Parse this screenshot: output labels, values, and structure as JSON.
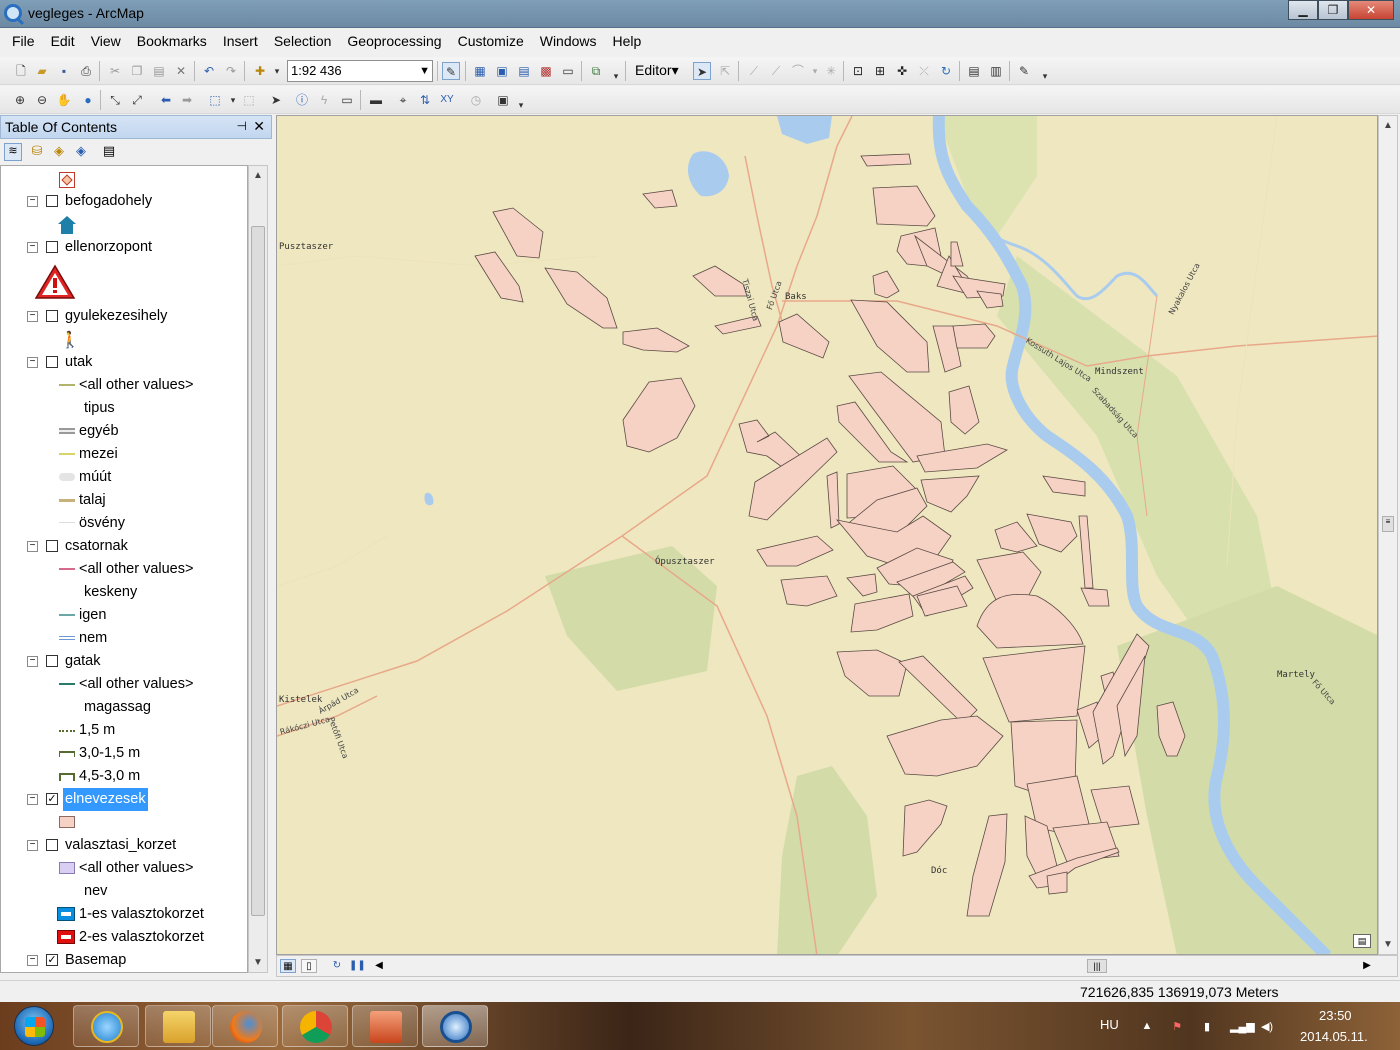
{
  "window": {
    "title": "vegleges - ArcMap",
    "minimize": "▁",
    "maximize": "❐",
    "close": "✕"
  },
  "menu": [
    "File",
    "Edit",
    "View",
    "Bookmarks",
    "Insert",
    "Selection",
    "Geoprocessing",
    "Customize",
    "Windows",
    "Help"
  ],
  "toolbar": {
    "scale": "1:92 436",
    "editor_label": "Editor▾"
  },
  "toc": {
    "title": "Table Of Contents",
    "pin": "⊣",
    "close": "✕",
    "layers": {
      "befogadohely": "befogadohely",
      "ellenorzopont": "ellenorzopont",
      "gyulekezesihely": "gyulekezesihely",
      "utak": "utak",
      "utak_other": "<all other values>",
      "utak_field": "tipus",
      "utak_v1": "egyéb",
      "utak_v2": "mezei",
      "utak_v3": "múút",
      "utak_v4": "talaj",
      "utak_v5": "ösvény",
      "csatornak": "csatornak",
      "csatornak_other": "<all other values>",
      "csatornak_field": "keskeny",
      "csatornak_v1": "igen",
      "csatornak_v2": "nem",
      "gatak": "gatak",
      "gatak_other": "<all other values>",
      "gatak_field": "magassag",
      "gatak_v1": "1,5 m",
      "gatak_v2": "3,0-1,5 m",
      "gatak_v3": "4,5-3,0 m",
      "elnevezesek": "elnevezesek",
      "valasztasi_korzet": "valasztasi_korzet",
      "vk_other": "<all other values>",
      "vk_field": "nev",
      "vk_v1": "1-es valasztokorzet",
      "vk_v2": "2-es valasztokorzet",
      "basemap": "Basemap"
    }
  },
  "map": {
    "places": {
      "pusztaszer": "Pusztaszer",
      "baks": "Baks",
      "mindszent": "Mindszent",
      "opusztaszer": "Ópusztaszer",
      "kistelek": "Kistelek",
      "martely": "Martely",
      "doc": "Dóc"
    },
    "streets": {
      "tiszai": "Tiszai Utca",
      "fo": "Fő Utca",
      "kossuth": "Kossuth Lajos Utca",
      "szabadsag": "Szabadság Utca",
      "nyakalos": "Nyakalos Utca",
      "arpad": "Árpád Utca",
      "rakoczi": "Rákóczi Utca",
      "petofi": "Petőfi Utca",
      "fo2": "Fő Utca"
    },
    "colors": {
      "background": "#efe7c0",
      "polygon_fill": "#f6d2c4",
      "polygon_stroke": "#5a4a44",
      "river": "#a9ccee",
      "forest": "#d3dca8"
    }
  },
  "status": {
    "coords": "721626,835  136919,073 Meters"
  },
  "taskbar": {
    "lang": "HU",
    "time": "23:50",
    "date": "2014.05.11."
  }
}
